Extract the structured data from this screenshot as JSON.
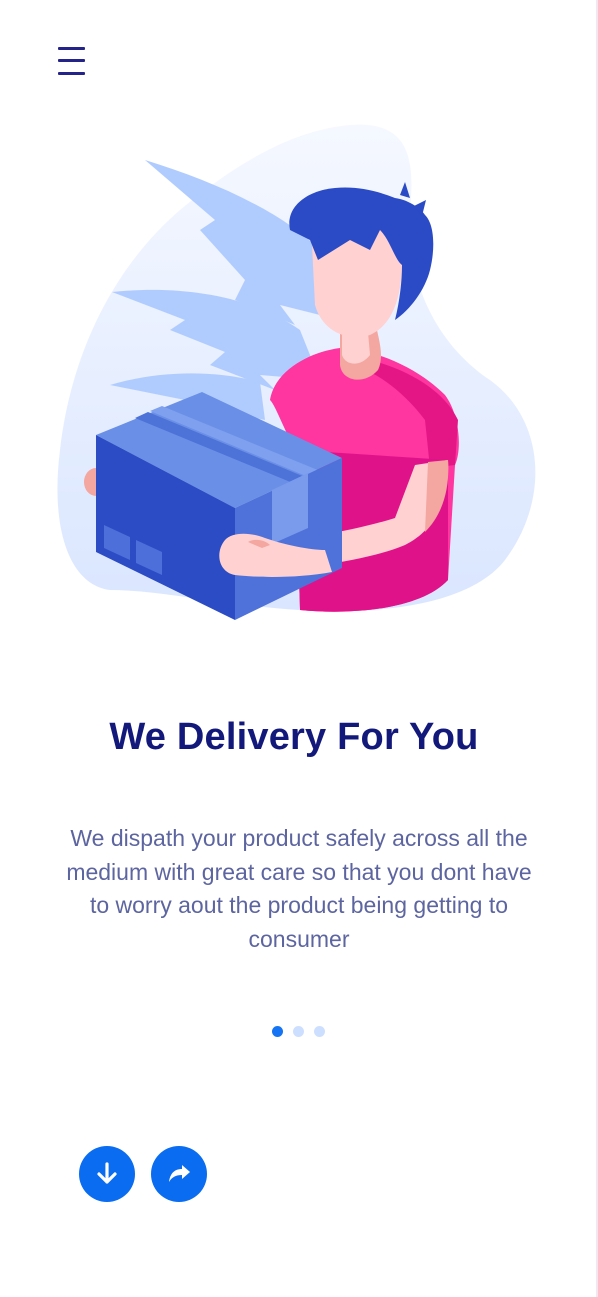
{
  "onboarding": {
    "title": "We Delivery For You",
    "description": "We dispath your product safely across all the medium with great care so that you dont have to worry aout the product being getting to consumer",
    "pager": {
      "total": 3,
      "current": 1
    }
  },
  "icons": {
    "menu": "hamburger-menu-icon",
    "next": "arrow-down-icon",
    "share": "share-forward-icon"
  },
  "colors": {
    "primary": "#0a6cf0",
    "title": "#13197a",
    "text": "#5d65a0",
    "dot_inactive": "#cddfff",
    "dot_active": "#1574f3"
  }
}
